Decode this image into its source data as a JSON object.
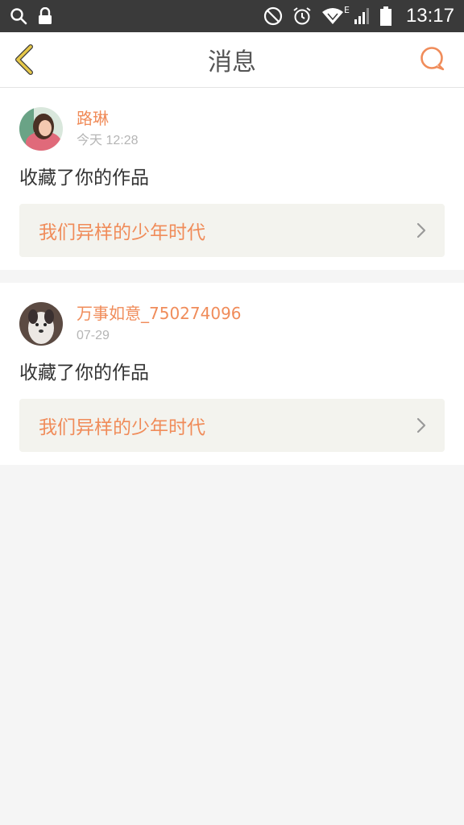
{
  "status_bar": {
    "time": "13:17",
    "network_label": "E",
    "icons": [
      "search-icon",
      "lock-icon",
      "do-not-disturb-icon",
      "alarm-icon",
      "wifi-icon",
      "signal-icon",
      "battery-icon"
    ]
  },
  "header": {
    "title": "消息",
    "back_icon": "chevron-left-icon",
    "right_icon": "chat-bubble-icon"
  },
  "colors": {
    "accent": "#f08c5a",
    "back_icon": "#e6c84a",
    "status_bar": "#3a3a3a",
    "link_background": "#f3f3ee"
  },
  "messages": [
    {
      "username": "路琳",
      "time": "今天 12:28",
      "action": "收藏了你的作品",
      "work_title": "我们异样的少年时代"
    },
    {
      "username": "万事如意_750274096",
      "time": "07-29",
      "action": "收藏了你的作品",
      "work_title": "我们异样的少年时代"
    }
  ]
}
